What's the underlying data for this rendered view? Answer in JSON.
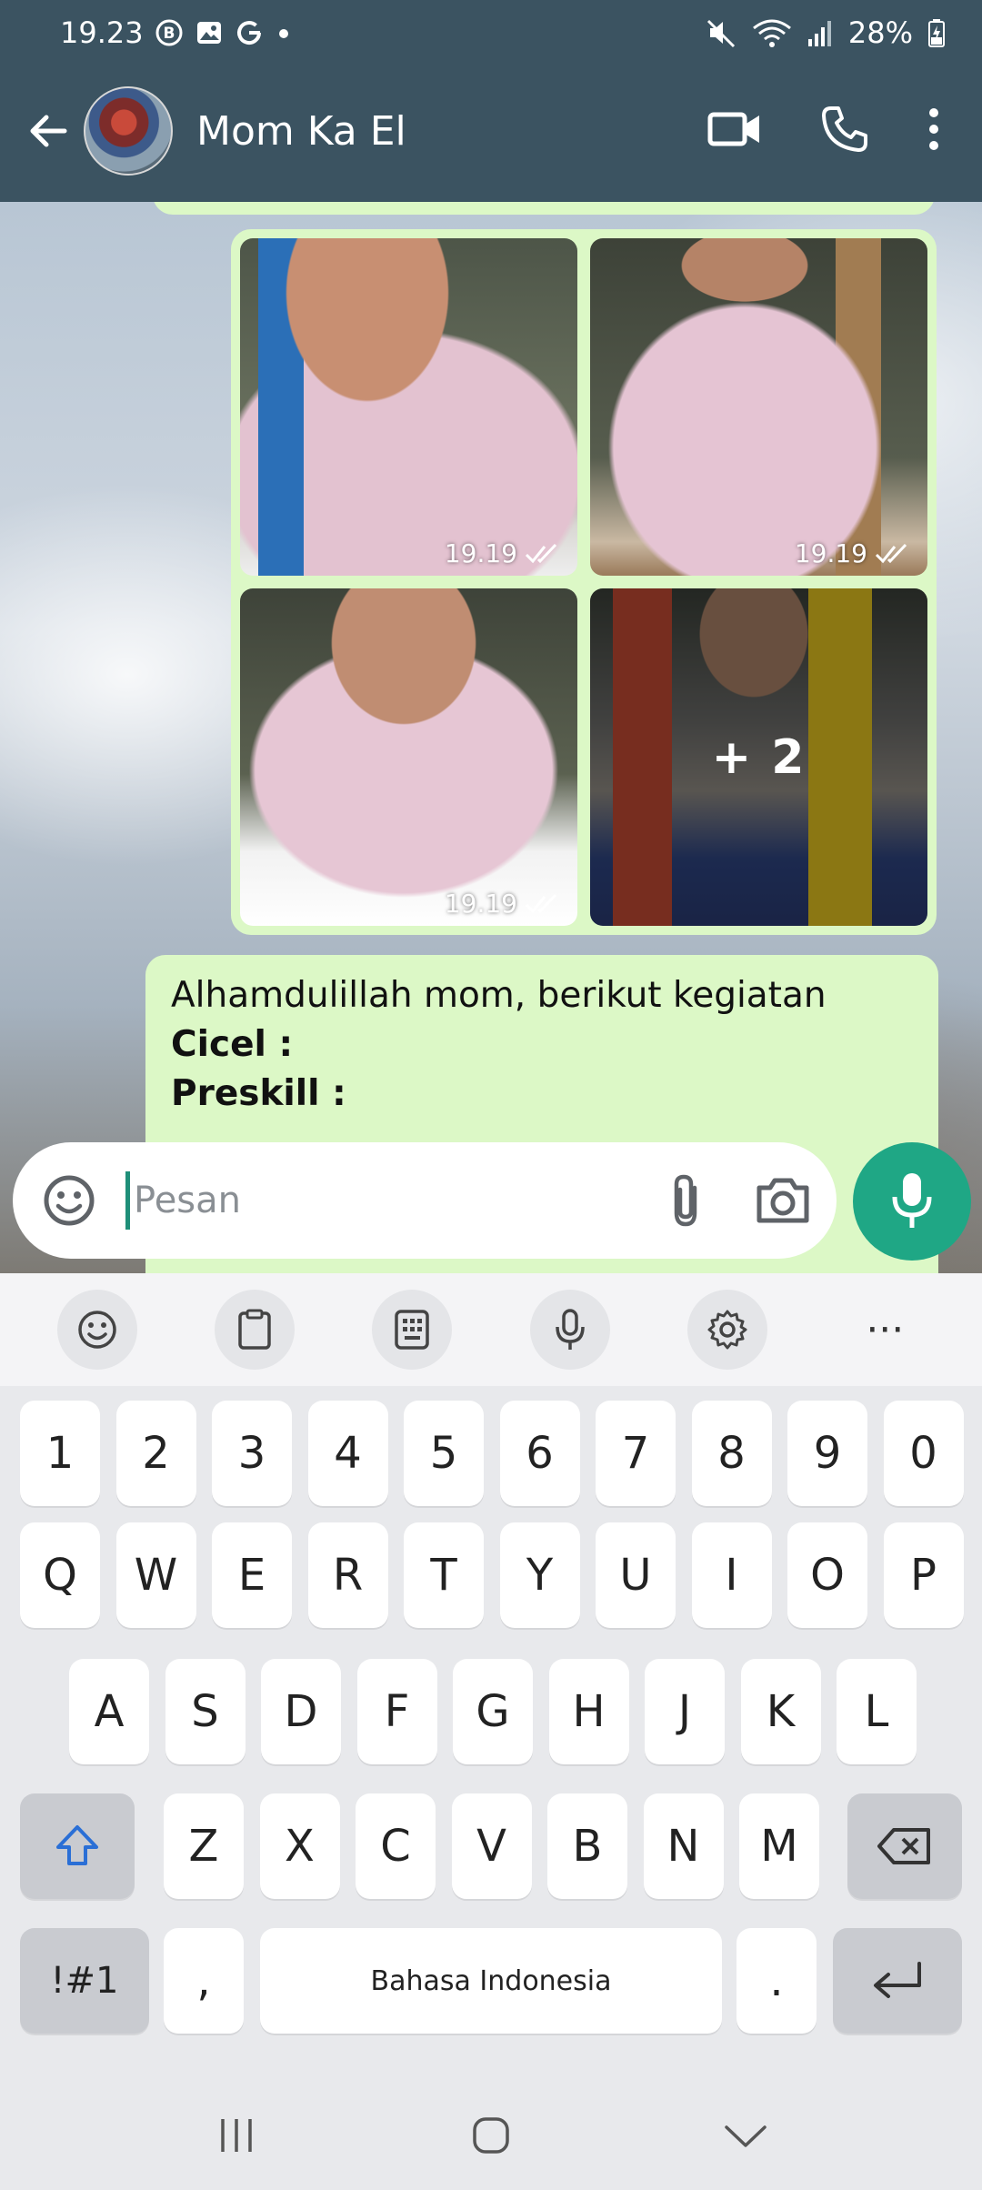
{
  "status_bar": {
    "time": "19.23",
    "battery": "28%",
    "left_icons": [
      "b-icon",
      "image-icon",
      "google-icon",
      "dot-icon"
    ],
    "right_icons": [
      "mute-icon",
      "wifi-icon",
      "signal-icon",
      "battery-charging-icon"
    ]
  },
  "header": {
    "contact_name": "Mom Ka El",
    "icons": [
      "back-arrow-icon",
      "video-call-icon",
      "phone-icon",
      "more-vert-icon"
    ]
  },
  "chat": {
    "media_message": {
      "photos": [
        {
          "time": "19.19",
          "ticks": "double-check"
        },
        {
          "time": "19.19",
          "ticks": "double-check"
        },
        {
          "time": "19.19",
          "ticks": "double-check"
        },
        {
          "more_count": "+ 2"
        }
      ]
    },
    "text_message": {
      "line1": "Alhamdulillah mom, berikut kegiatan",
      "line2": "Cicel :",
      "line3": "Preskill :"
    }
  },
  "composer": {
    "placeholder": "Pesan",
    "icons": [
      "emoji-icon",
      "attach-icon",
      "camera-icon",
      "mic-icon"
    ]
  },
  "keyboard": {
    "toolbar_icons": [
      "emoji-icon",
      "clipboard-icon",
      "keypad-icon",
      "voice-icon",
      "settings-icon",
      "more-icon"
    ],
    "more_label": "···",
    "number_row": [
      "1",
      "2",
      "3",
      "4",
      "5",
      "6",
      "7",
      "8",
      "9",
      "0"
    ],
    "row1": [
      "Q",
      "W",
      "E",
      "R",
      "T",
      "Y",
      "U",
      "I",
      "O",
      "P"
    ],
    "row2": [
      "A",
      "S",
      "D",
      "F",
      "G",
      "H",
      "J",
      "K",
      "L"
    ],
    "row3": [
      "Z",
      "X",
      "C",
      "V",
      "B",
      "N",
      "M"
    ],
    "symbols_label": "!#1",
    "comma_label": ",",
    "space_label": "Bahasa Indonesia",
    "period_label": ".",
    "colors": {
      "shift": "#2a6fd6",
      "accent": "#1fa785"
    }
  },
  "navbar": {
    "icons": [
      "recent-apps-icon",
      "home-icon",
      "back-chevron-icon"
    ]
  }
}
